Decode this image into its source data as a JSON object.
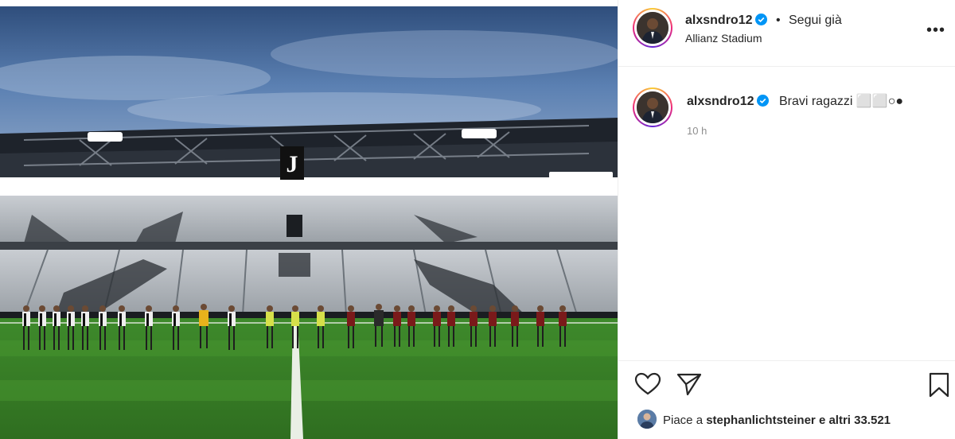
{
  "post": {
    "image_alt": "Allianz Stadium - teams lined up on the pitch",
    "stadium_logo_text": "J"
  },
  "header": {
    "username": "alxsndro12",
    "separator": "•",
    "follow_status": "Segui già",
    "location": "Allianz Stadium",
    "more_label": "•••"
  },
  "comment": {
    "username": "alxsndro12",
    "text": "Bravi ragazzi ⬜⬜○●",
    "time": "10 h"
  },
  "actions": {
    "like_icon": "heart-icon",
    "share_icon": "paper-plane-icon",
    "save_icon": "bookmark-icon"
  },
  "likes": {
    "prefix": "Piace a",
    "user": "stephanlichtsteiner",
    "suffix": "e altri 33.521"
  },
  "colors": {
    "verified": "#0095f6",
    "pitch": "#3f8a2c",
    "sky": "#4a6e9e"
  }
}
